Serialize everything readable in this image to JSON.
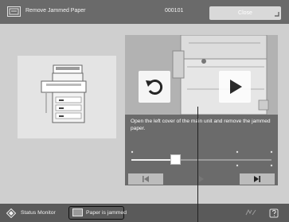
{
  "titlebar": {
    "icon": "printer-jam-icon",
    "title": "Remove Jammed Paper",
    "job_id": "000101",
    "close_label": "Close"
  },
  "video": {
    "caption": "Open the left cover of the main unit and remove the jammed paper.",
    "progress": 0.3,
    "controls": {
      "replay": "replay-icon",
      "play": "play-icon",
      "skip_back": "skip-to-start-icon",
      "play_pause": "play-icon",
      "skip_forward": "skip-to-end-icon"
    }
  },
  "bottombar": {
    "status_monitor_label": "Status Monitor",
    "status_label": "Paper is jammed",
    "icons": [
      "status-monitor-icon",
      "paper-jam-icon",
      "energy-saver-icon",
      "help-icon"
    ]
  },
  "colors": {
    "titlebar": "#6a6a6a",
    "panel": "#cfcfcf",
    "video_panel": "#6b6b6b",
    "bottombar": "#5a5a5a"
  }
}
